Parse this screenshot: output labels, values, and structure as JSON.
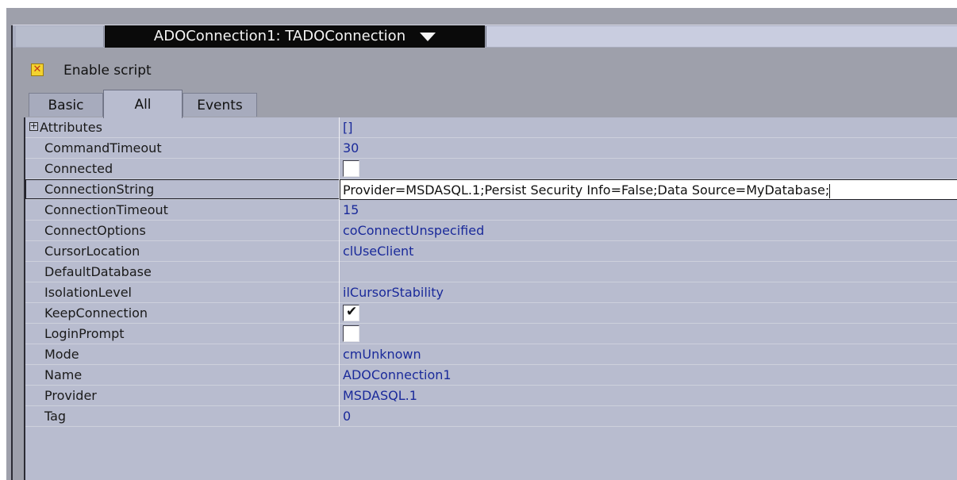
{
  "window": {
    "object_selector": "ADOConnection1: TADOConnection",
    "enable_script_label": "Enable script",
    "enable_script_checked": true
  },
  "tabs": [
    {
      "label": "Basic",
      "active": false
    },
    {
      "label": "All",
      "active": true
    },
    {
      "label": "Events",
      "active": false
    }
  ],
  "properties": [
    {
      "name": "Attributes",
      "value": "[]",
      "expandable": true
    },
    {
      "name": "CommandTimeout",
      "value": "30"
    },
    {
      "name": "Connected",
      "checkbox": true,
      "checked": false
    },
    {
      "name": "ConnectionString",
      "value": "Provider=MSDASQL.1;Persist Security Info=False;Data Source=MyDatabase;",
      "editing": true
    },
    {
      "name": "ConnectionTimeout",
      "value": "15"
    },
    {
      "name": "ConnectOptions",
      "value": "coConnectUnspecified"
    },
    {
      "name": "CursorLocation",
      "value": "clUseClient"
    },
    {
      "name": "DefaultDatabase",
      "value": ""
    },
    {
      "name": "IsolationLevel",
      "value": "ilCursorStability"
    },
    {
      "name": "KeepConnection",
      "checkbox": true,
      "checked": true
    },
    {
      "name": "LoginPrompt",
      "checkbox": true,
      "checked": false
    },
    {
      "name": "Mode",
      "value": "cmUnknown"
    },
    {
      "name": "Name",
      "value": "ADOConnection1"
    },
    {
      "name": "Provider",
      "value": "MSDASQL.1"
    },
    {
      "name": "Tag",
      "value": "0"
    }
  ],
  "colors": {
    "panel_bg": "#b8bccf",
    "value_text": "#1a2a9a",
    "selector_bg": "#0a0a0a"
  }
}
